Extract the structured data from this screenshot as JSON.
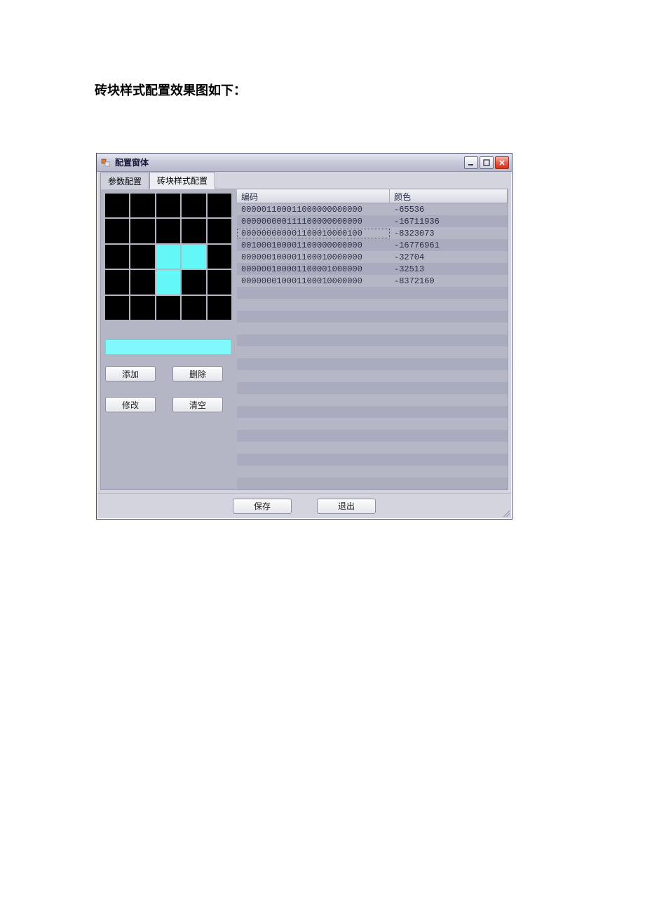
{
  "caption": "砖块样式配置效果图如下：",
  "window": {
    "title": "配置窗体"
  },
  "tabs": [
    {
      "label": "参数配置",
      "active": false
    },
    {
      "label": "砖块样式配置",
      "active": true
    }
  ],
  "grid": {
    "cells": [
      [
        0,
        0,
        0,
        0,
        0
      ],
      [
        0,
        0,
        0,
        0,
        0
      ],
      [
        0,
        0,
        1,
        1,
        0
      ],
      [
        0,
        0,
        1,
        0,
        0
      ],
      [
        0,
        0,
        0,
        0,
        0
      ]
    ]
  },
  "color_preview": "#7ff9f9",
  "buttons": {
    "add": "添加",
    "delete": "删除",
    "modify": "修改",
    "clear": "清空",
    "save": "保存",
    "exit": "退出"
  },
  "listview": {
    "headers": {
      "code": "编码",
      "color": "颜色"
    },
    "rows": [
      {
        "code": "000001100011000000000000",
        "color": "-65536"
      },
      {
        "code": "000000000111100000000000",
        "color": "-16711936"
      },
      {
        "code": "000000000001100010000100",
        "color": "-8323073",
        "selected": true
      },
      {
        "code": "001000100001100000000000",
        "color": "-16776961"
      },
      {
        "code": "000000100001100010000000",
        "color": "-32704"
      },
      {
        "code": "000000100001100001000000",
        "color": "-32513"
      },
      {
        "code": "000000010001100010000000",
        "color": "-8372160"
      }
    ],
    "empty_rows": 16
  }
}
